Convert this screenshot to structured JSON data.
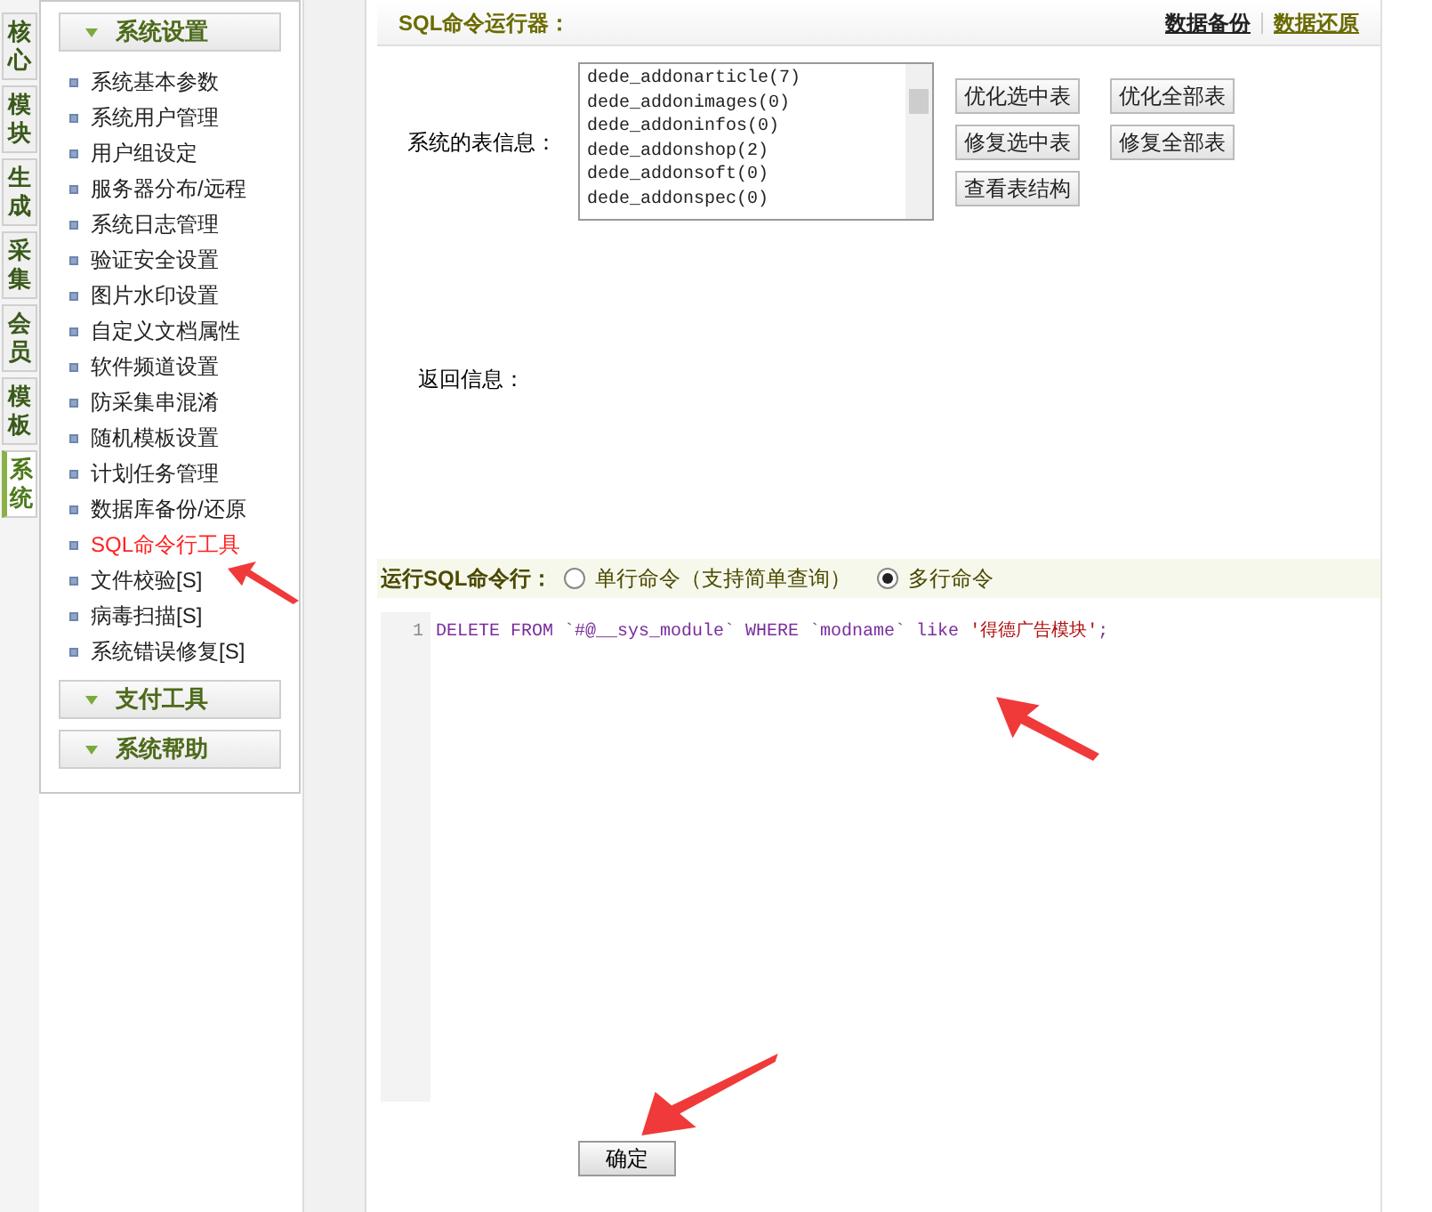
{
  "side_tabs": [
    {
      "label": "核心",
      "selected": false
    },
    {
      "label": "模块",
      "selected": false
    },
    {
      "label": "生成",
      "selected": false
    },
    {
      "label": "采集",
      "selected": false
    },
    {
      "label": "会员",
      "selected": false
    },
    {
      "label": "模板",
      "selected": false
    },
    {
      "label": "系统",
      "selected": true
    }
  ],
  "sidebar": {
    "groups": [
      {
        "title": "系统设置",
        "items": [
          {
            "label": "系统基本参数",
            "selected": false
          },
          {
            "label": "系统用户管理",
            "selected": false
          },
          {
            "label": "用户组设定",
            "selected": false
          },
          {
            "label": "服务器分布/远程",
            "selected": false
          },
          {
            "label": "系统日志管理",
            "selected": false
          },
          {
            "label": "验证安全设置",
            "selected": false
          },
          {
            "label": "图片水印设置",
            "selected": false
          },
          {
            "label": "自定义文档属性",
            "selected": false
          },
          {
            "label": "软件频道设置",
            "selected": false
          },
          {
            "label": "防采集串混淆",
            "selected": false
          },
          {
            "label": "随机模板设置",
            "selected": false
          },
          {
            "label": "计划任务管理",
            "selected": false
          },
          {
            "label": "数据库备份/还原",
            "selected": false
          },
          {
            "label": "SQL命令行工具",
            "selected": true
          },
          {
            "label": "文件校验[S]",
            "selected": false
          },
          {
            "label": "病毒扫描[S]",
            "selected": false
          },
          {
            "label": "系统错误修复[S]",
            "selected": false
          }
        ]
      },
      {
        "title": "支付工具"
      },
      {
        "title": "系统帮助"
      }
    ]
  },
  "main": {
    "title": "SQL命令运行器：",
    "links": [
      "数据备份",
      "数据还原"
    ],
    "table_info_label": "系统的表信息：",
    "tables": [
      "dede_addonarticle(7)",
      "dede_addonimages(0)",
      "dede_addoninfos(0)",
      "dede_addonshop(2)",
      "dede_addonsoft(0)",
      "dede_addonspec(0)"
    ],
    "buttons": [
      [
        "优化选中表",
        "优化全部表"
      ],
      [
        "修复选中表",
        "修复全部表"
      ],
      [
        "查看表结构"
      ]
    ],
    "return_label": "返回信息：",
    "run_label": "运行SQL命令行：",
    "modes": [
      {
        "label": "单行命令（支持简单查询）",
        "selected": false
      },
      {
        "label": "多行命令",
        "selected": true
      }
    ],
    "editor_lines": [
      {
        "number": "1",
        "segments": [
          {
            "kind": "code",
            "text": "DELETE FROM `#@__sys_module` WHERE `modname` like "
          },
          {
            "kind": "string",
            "text": "'得德广告模块'"
          },
          {
            "kind": "code",
            "text": ";"
          }
        ]
      }
    ],
    "submit": "确定"
  }
}
